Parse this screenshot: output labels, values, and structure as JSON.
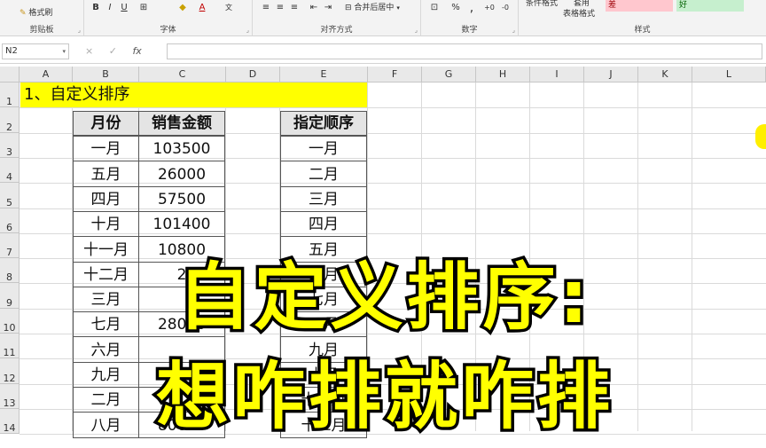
{
  "ribbon": {
    "clipboard": {
      "format_painter": "格式刷",
      "label": "剪贴板"
    },
    "font": {
      "bold": "B",
      "italic": "I",
      "underline": "U",
      "label": "字体"
    },
    "alignment": {
      "merge_center": "合并后居中",
      "label": "对齐方式"
    },
    "number": {
      "percent": "%",
      "label": "数字"
    },
    "styles": {
      "conditional": "条件格式",
      "table_format_1": "套用",
      "table_format_2": "表格格式",
      "bad": "差",
      "good": "好",
      "label": "样式"
    }
  },
  "formula_bar": {
    "name_box": "N2",
    "fx": "fx",
    "cancel": "×",
    "confirm": "✓",
    "content": ""
  },
  "sheet": {
    "columns": [
      "A",
      "B",
      "C",
      "D",
      "E",
      "F",
      "G",
      "H",
      "I",
      "J",
      "K",
      "L"
    ],
    "rows": [
      "1",
      "2",
      "3",
      "4",
      "5",
      "6",
      "7",
      "8",
      "9",
      "10",
      "11",
      "12",
      "13",
      "14"
    ],
    "title": "1、自定义排序",
    "table1": {
      "headers": [
        "月份",
        "销售金额"
      ],
      "rows": [
        [
          "一月",
          "103500"
        ],
        [
          "五月",
          "26000"
        ],
        [
          "四月",
          "57500"
        ],
        [
          "十月",
          "101400"
        ],
        [
          "十一月",
          "10800"
        ],
        [
          "十二月",
          "2"
        ],
        [
          "三月",
          ""
        ],
        [
          "七月",
          "28000"
        ],
        [
          "六月",
          ""
        ],
        [
          "九月",
          "0"
        ],
        [
          "二月",
          ""
        ],
        [
          "八月",
          "80600"
        ]
      ]
    },
    "table2": {
      "header": "指定顺序",
      "rows": [
        "一月",
        "二月",
        "三月",
        "四月",
        "五月",
        "六月",
        "七月",
        "八月",
        "九月",
        "十月",
        "十一月",
        "十二月"
      ]
    }
  },
  "overlay": {
    "line1": "自定义排序:",
    "line2": "想咋排就咋排"
  },
  "colors": {
    "title_fill": "#ffff00",
    "overlay_text": "#ffff00",
    "bad_fill": "#ffc7ce",
    "good_fill": "#c6efce"
  }
}
